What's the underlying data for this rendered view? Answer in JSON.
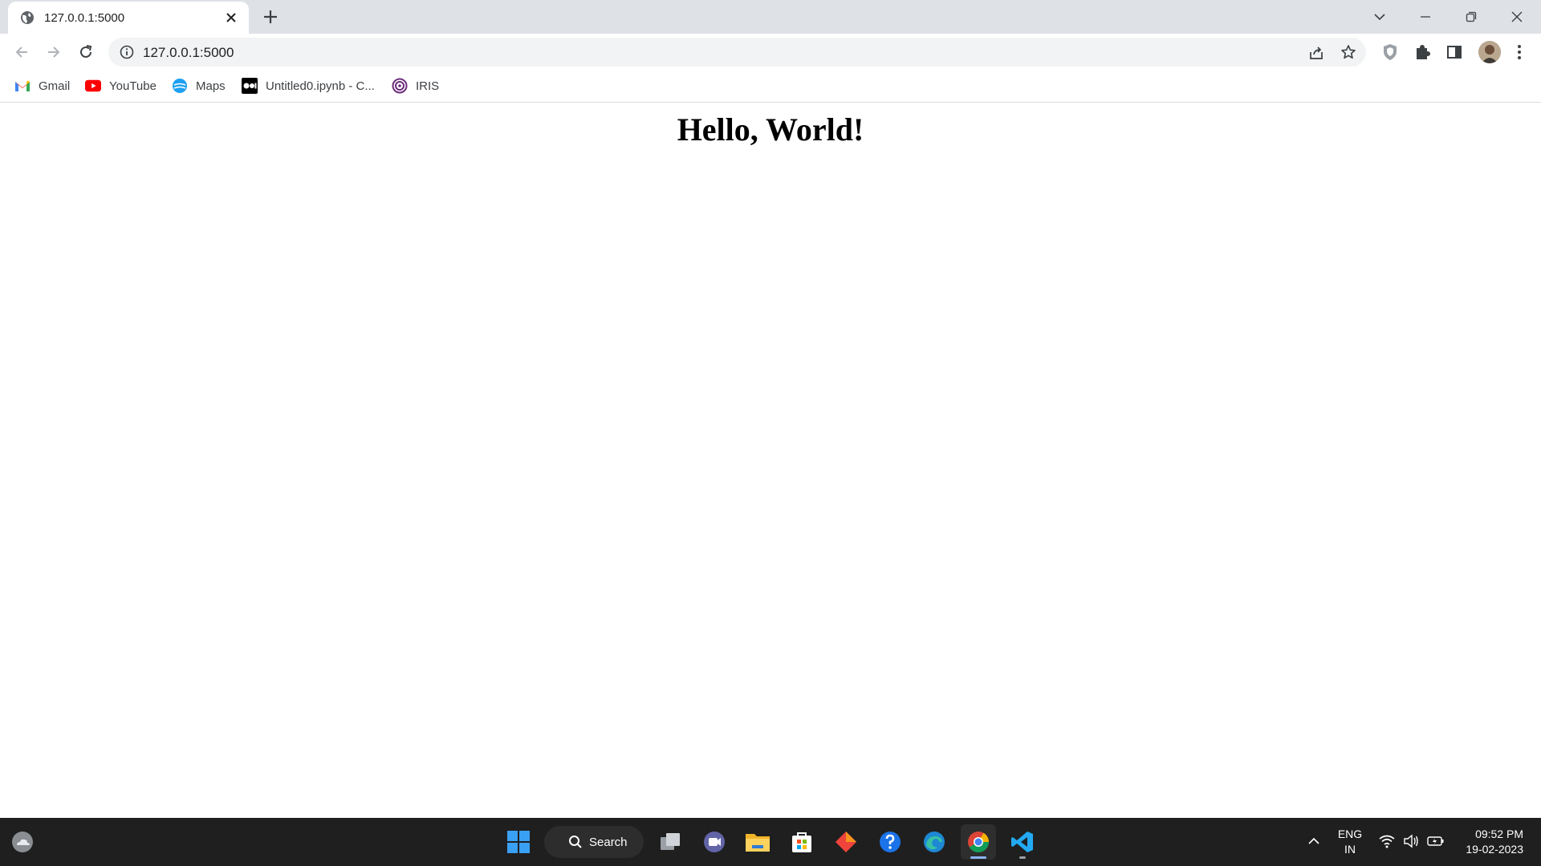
{
  "browser": {
    "tab": {
      "title": "127.0.0.1:5000",
      "favicon": "globe-icon"
    },
    "omnibox": {
      "url": "127.0.0.1:5000"
    },
    "bookmarks": [
      {
        "label": "Gmail",
        "icon": "gmail-icon"
      },
      {
        "label": "YouTube",
        "icon": "youtube-icon"
      },
      {
        "label": "Maps",
        "icon": "maps-icon"
      },
      {
        "label": "Untitled0.ipynb - C...",
        "icon": "colab-icon"
      },
      {
        "label": "IRIS",
        "icon": "iris-icon"
      }
    ]
  },
  "page": {
    "heading": "Hello, World!"
  },
  "taskbar": {
    "search_label": "Search",
    "language": {
      "line1": "ENG",
      "line2": "IN"
    },
    "clock": {
      "time": "09:52 PM",
      "date": "19-02-2023"
    }
  },
  "colors": {
    "tabstrip": "#dee1e6",
    "omnibox": "#f1f3f4",
    "taskbar": "#1f1f1f",
    "accent": "#1a73e8"
  }
}
